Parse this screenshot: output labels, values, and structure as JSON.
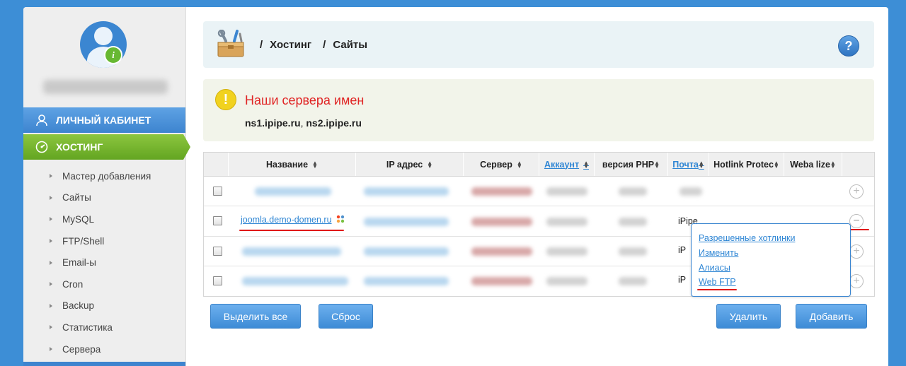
{
  "sidebar": {
    "menu": [
      {
        "label": "ЛИЧНЫЙ КАБИНЕТ",
        "icon": "user-icon"
      },
      {
        "label": "ХОСТИНГ",
        "icon": "gauge-icon"
      }
    ],
    "items": [
      {
        "label": "Мастер добавления"
      },
      {
        "label": "Сайты"
      },
      {
        "label": "MySQL"
      },
      {
        "label": "FTP/Shell"
      },
      {
        "label": "Email-ы"
      },
      {
        "label": "Cron"
      },
      {
        "label": "Backup"
      },
      {
        "label": "Статистика"
      },
      {
        "label": "Сервера"
      }
    ]
  },
  "header": {
    "sep1": "/",
    "crumb1": "Хостинг",
    "sep2": "/",
    "crumb2": "Сайты",
    "help": "?"
  },
  "notice": {
    "icon": "!",
    "title": "Наши сервера имен",
    "ns1": "ns1.ipipe.ru",
    "sep": ",",
    "ns2": "ns2.ipipe.ru"
  },
  "table": {
    "headers": [
      "Название",
      "IP адрес",
      "Сервер",
      "Аккаунт",
      "версия PHP",
      "Почта",
      "Hotlink Protec",
      "Weba lize"
    ],
    "rows": [
      {
        "domain": "",
        "ipipe": ""
      },
      {
        "domain": "joomla.demo-domen.ru",
        "ipipe": "iPipe"
      },
      {
        "domain": "",
        "ipipe": "iP"
      },
      {
        "domain": "",
        "ipipe": "iP"
      }
    ]
  },
  "popup": {
    "items": [
      "Разрешенные хотлинки",
      "Изменить",
      "Алиасы",
      "Web FTP"
    ]
  },
  "buttons": {
    "select_all": "Выделить все",
    "reset": "Сброс",
    "delete": "Удалить",
    "add": "Добавить"
  },
  "colors": {
    "accent_blue": "#3d8bd6",
    "hosting_green": "#63a521",
    "warning_red": "#e02424",
    "link_blue": "#2f86d4"
  }
}
